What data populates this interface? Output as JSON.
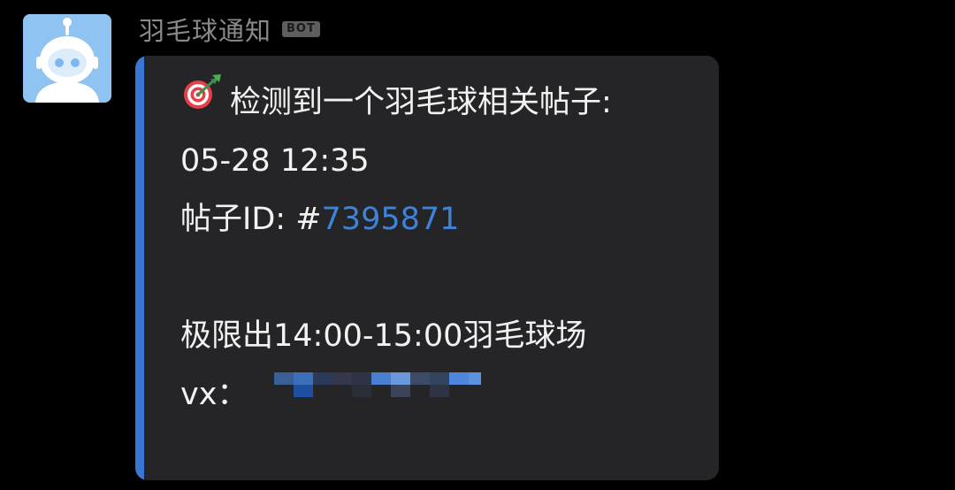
{
  "sender": {
    "name": "羽毛球通知",
    "badge": "BOT"
  },
  "message": {
    "header": "检测到一个羽毛球相关帖子:",
    "header_icon": "dart-target-icon",
    "time": "05-28 12:35",
    "post_id_label": "帖子ID: #",
    "post_id": "7395871",
    "content": "极限出14:00-15:00羽毛球场",
    "contact_label": "vx："
  },
  "colors": {
    "background": "#000000",
    "bubble": "#252527",
    "accent_bar": "#3a76d3",
    "link": "#3f82d8",
    "text": "#f2f2f2",
    "sender": "#8a8a8a"
  }
}
